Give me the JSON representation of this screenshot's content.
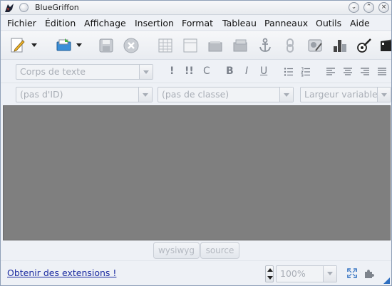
{
  "window": {
    "title": "BlueGriffon"
  },
  "menubar": {
    "items": [
      "Fichier",
      "Édition",
      "Affichage",
      "Insertion",
      "Format",
      "Tableau",
      "Panneaux",
      "Outils",
      "Aide"
    ]
  },
  "format_bar": {
    "paragraph_style": "Corps de texte",
    "buttons": [
      "!",
      "!!",
      "C",
      "B",
      "I",
      "U"
    ]
  },
  "selector_bar": {
    "id_select": "(pas d'ID)",
    "class_select": "(pas de classe)",
    "width_select": "Largeur variable"
  },
  "mode_tabs": [
    "wysiwyg",
    "source"
  ],
  "statusbar": {
    "extensions_link": "Obtenir des extensions !",
    "zoom": "100%"
  }
}
